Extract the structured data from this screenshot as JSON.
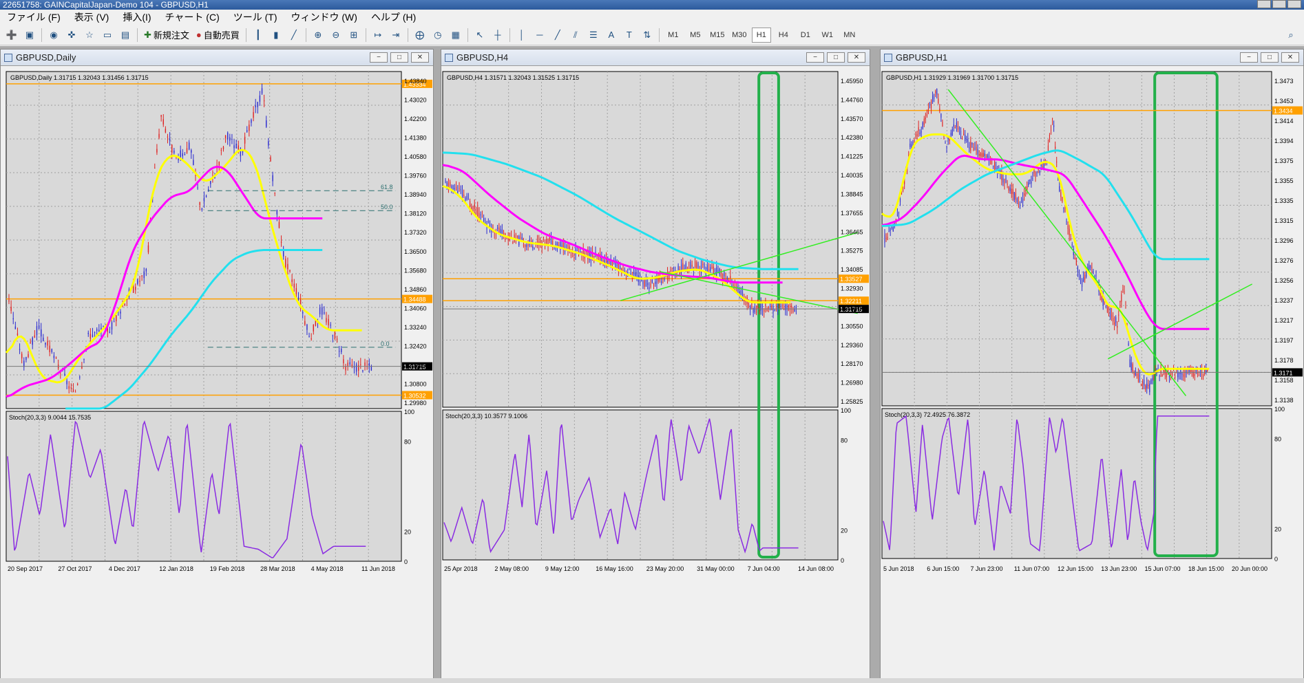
{
  "titlebar": {
    "title": "22651758: GAINCapitalJapan-Demo 104 - GBPUSD,H1"
  },
  "menu": [
    "ファイル (F)",
    "表示 (V)",
    "挿入(I)",
    "チャート (C)",
    "ツール (T)",
    "ウィンドウ (W)",
    "ヘルプ (H)"
  ],
  "toolbar": {
    "new_order": "新規注文",
    "auto_trade": "自動売買",
    "timeframes": [
      "M1",
      "M5",
      "M15",
      "M30",
      "H1",
      "H4",
      "D1",
      "W1",
      "MN"
    ],
    "active_timeframe": "H1"
  },
  "colors": {
    "chart_bg": "#d9d9d9",
    "grid": "#a0a0a0",
    "ma_fast": "#ffff00",
    "ma_mid": "#ff00ff",
    "ma_slow": "#22e0ee",
    "level": "#ffa000",
    "stoch": "#8a2be2",
    "highlight": "#22b04a",
    "trendline": "#33ee22"
  },
  "windows": [
    {
      "title": "GBPUSD,Daily",
      "info": "GBPUSD,Daily  1.31715 1.32043 1.31456 1.31715",
      "stoch_label": "Stoch(20,3,3) 9.0044 15.7535",
      "price_ticks": [
        "1.43840",
        "1.43020",
        "1.42200",
        "1.41380",
        "1.40580",
        "1.39760",
        "1.38940",
        "1.38120",
        "1.37320",
        "1.36500",
        "1.35680",
        "1.34860",
        "1.34060",
        "1.33240",
        "1.32420",
        "1.31600",
        "1.30800",
        "1.29980"
      ],
      "level_tags": [
        "1.43334",
        "1.34488",
        "1.30532"
      ],
      "current_price": "1.31715",
      "fib_labels": [
        "61.8",
        "50.0",
        "0.0"
      ],
      "stoch_ticks": [
        "100",
        "80",
        "20",
        "0"
      ],
      "date_ticks": [
        "20 Sep 2017",
        "27 Oct 2017",
        "4 Dec 2017",
        "12 Jan 2018",
        "19 Feb 2018",
        "28 Mar 2018",
        "4 May 2018",
        "11 Jun 2018"
      ]
    },
    {
      "title": "GBPUSD,H4",
      "info": "GBPUSD,H4  1.31571 1.32043 1.31525 1.31715",
      "stoch_label": "Stoch(20,3,3) 10.3577 9.1006",
      "price_ticks": [
        "1.45950",
        "1.44760",
        "1.43570",
        "1.42380",
        "1.41225",
        "1.40035",
        "1.38845",
        "1.37655",
        "1.36465",
        "1.35275",
        "1.34085",
        "1.32930",
        "1.31740",
        "1.30550",
        "1.29360",
        "1.28170",
        "1.26980",
        "1.25825"
      ],
      "level_tags": [
        "1.33527",
        "1.32211"
      ],
      "current_price": "1.31715",
      "stoch_ticks": [
        "100",
        "80",
        "20",
        "0"
      ],
      "date_ticks": [
        "25 Apr 2018",
        "2 May 08:00",
        "9 May 12:00",
        "16 May 16:00",
        "23 May 20:00",
        "31 May 00:00",
        "7 Jun 04:00",
        "14 Jun 08:00"
      ]
    },
    {
      "title": "GBPUSD,H1",
      "info": "GBPUSD,H1  1.31929 1.31969 1.31700 1.31715",
      "stoch_label": "Stoch(20,3,3) 72.4925 76.3872",
      "price_ticks": [
        "1.3473",
        "1.3453",
        "1.3414",
        "1.3394",
        "1.3375",
        "1.3355",
        "1.3335",
        "1.3315",
        "1.3296",
        "1.3276",
        "1.3256",
        "1.3237",
        "1.3217",
        "1.3197",
        "1.3178",
        "1.3158",
        "1.3138"
      ],
      "level_tags": [
        "1.3434"
      ],
      "current_price": "1.3171",
      "stoch_ticks": [
        "100",
        "80",
        "20",
        "0"
      ],
      "date_ticks": [
        "5 Jun 2018",
        "6 Jun 15:00",
        "7 Jun 23:00",
        "11 Jun 07:00",
        "12 Jun 15:00",
        "13 Jun 23:00",
        "15 Jun 07:00",
        "18 Jun 15:00",
        "20 Jun 00:00"
      ]
    }
  ]
}
